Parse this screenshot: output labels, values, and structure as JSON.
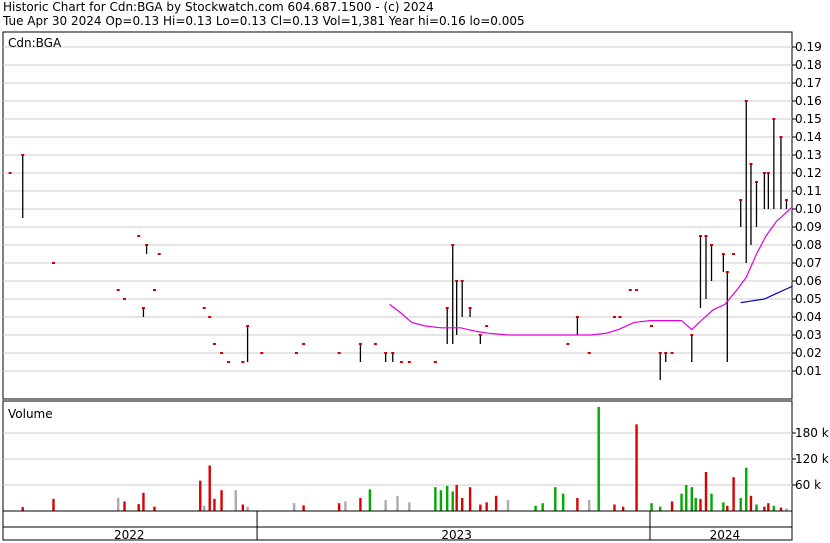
{
  "header": {
    "line1": "Historic Chart for Cdn:BGA by Stockwatch.com 604.687.1500 - (c) 2024",
    "line2": "Tue Apr 30 2024  Op=0.13  Hi=0.13  Lo=0.13  Cl=0.13  Vol=1,381  Year hi=0.16  lo=0.005"
  },
  "chart_data": [
    {
      "type": "ohlc",
      "title": "Cdn:BGA",
      "yticks": [
        "0.19",
        "0.18",
        "0.17",
        "0.16",
        "0.15",
        "0.14",
        "0.13",
        "0.12",
        "0.11",
        "0.10",
        "0.09",
        "0.08",
        "0.07",
        "0.06",
        "0.05",
        "0.04",
        "0.03",
        "0.02",
        "0.01"
      ],
      "ylim": [
        0,
        0.19
      ],
      "xlim": [
        0,
        100
      ],
      "x_axis_note": "x in fractional timeline units; 2022 starts at 0, 2023 at 34.3, 2024 at 84.4",
      "grid": true,
      "colors": {
        "bars": "#000000",
        "close_tick": "#cc0000",
        "ma_short": "#e000e0",
        "ma_long": "#0000cc",
        "grid": "#cccccc"
      },
      "bars": [
        {
          "x": 0.9,
          "l": 0.12,
          "h": 0.12
        },
        {
          "x": 2.5,
          "l": 0.095,
          "h": 0.13
        },
        {
          "x": 6.4,
          "l": 0.07,
          "h": 0.07
        },
        {
          "x": 14.6,
          "l": 0.055,
          "h": 0.055
        },
        {
          "x": 15.4,
          "l": 0.05,
          "h": 0.05
        },
        {
          "x": 17.2,
          "l": 0.085,
          "h": 0.085
        },
        {
          "x": 17.8,
          "l": 0.04,
          "h": 0.045
        },
        {
          "x": 18.2,
          "l": 0.075,
          "h": 0.08
        },
        {
          "x": 19.2,
          "l": 0.055,
          "h": 0.055
        },
        {
          "x": 19.8,
          "l": 0.075,
          "h": 0.075
        },
        {
          "x": 25.5,
          "l": 0.045,
          "h": 0.045
        },
        {
          "x": 26.2,
          "l": 0.04,
          "h": 0.04
        },
        {
          "x": 26.8,
          "l": 0.025,
          "h": 0.025
        },
        {
          "x": 27.7,
          "l": 0.02,
          "h": 0.02
        },
        {
          "x": 28.6,
          "l": 0.015,
          "h": 0.015
        },
        {
          "x": 30.4,
          "l": 0.015,
          "h": 0.015
        },
        {
          "x": 31.0,
          "l": 0.015,
          "h": 0.035
        },
        {
          "x": 32.8,
          "l": 0.02,
          "h": 0.02
        },
        {
          "x": 37.2,
          "l": 0.02,
          "h": 0.02
        },
        {
          "x": 38.1,
          "l": 0.025,
          "h": 0.025
        },
        {
          "x": 42.6,
          "l": 0.02,
          "h": 0.02
        },
        {
          "x": 45.3,
          "l": 0.015,
          "h": 0.025
        },
        {
          "x": 47.2,
          "l": 0.025,
          "h": 0.025
        },
        {
          "x": 48.5,
          "l": 0.015,
          "h": 0.02
        },
        {
          "x": 49.4,
          "l": 0.015,
          "h": 0.02
        },
        {
          "x": 50.5,
          "l": 0.015,
          "h": 0.015
        },
        {
          "x": 51.5,
          "l": 0.015,
          "h": 0.015
        },
        {
          "x": 54.8,
          "l": 0.015,
          "h": 0.015
        },
        {
          "x": 56.3,
          "l": 0.025,
          "h": 0.045
        },
        {
          "x": 57.0,
          "l": 0.025,
          "h": 0.08
        },
        {
          "x": 57.5,
          "l": 0.03,
          "h": 0.06
        },
        {
          "x": 58.2,
          "l": 0.04,
          "h": 0.06
        },
        {
          "x": 59.2,
          "l": 0.04,
          "h": 0.045
        },
        {
          "x": 60.5,
          "l": 0.025,
          "h": 0.03
        },
        {
          "x": 61.3,
          "l": 0.035,
          "h": 0.035
        },
        {
          "x": 71.6,
          "l": 0.025,
          "h": 0.025
        },
        {
          "x": 72.8,
          "l": 0.03,
          "h": 0.04
        },
        {
          "x": 74.3,
          "l": 0.02,
          "h": 0.02
        },
        {
          "x": 77.5,
          "l": 0.04,
          "h": 0.04
        },
        {
          "x": 78.2,
          "l": 0.04,
          "h": 0.04
        },
        {
          "x": 79.5,
          "l": 0.055,
          "h": 0.055
        },
        {
          "x": 80.3,
          "l": 0.055,
          "h": 0.055
        },
        {
          "x": 82.2,
          "l": 0.035,
          "h": 0.035
        },
        {
          "x": 83.3,
          "l": 0.005,
          "h": 0.02
        },
        {
          "x": 84.0,
          "l": 0.015,
          "h": 0.02
        },
        {
          "x": 84.8,
          "l": 0.02,
          "h": 0.02
        },
        {
          "x": 87.3,
          "l": 0.015,
          "h": 0.03
        },
        {
          "x": 88.4,
          "l": 0.045,
          "h": 0.085
        },
        {
          "x": 89.1,
          "l": 0.05,
          "h": 0.085
        },
        {
          "x": 89.8,
          "l": 0.06,
          "h": 0.08
        },
        {
          "x": 91.3,
          "l": 0.065,
          "h": 0.075
        },
        {
          "x": 91.8,
          "l": 0.015,
          "h": 0.065
        },
        {
          "x": 92.6,
          "l": 0.075,
          "h": 0.075
        },
        {
          "x": 93.5,
          "l": 0.09,
          "h": 0.105
        },
        {
          "x": 94.2,
          "l": 0.07,
          "h": 0.16
        },
        {
          "x": 94.8,
          "l": 0.08,
          "h": 0.125
        },
        {
          "x": 95.5,
          "l": 0.09,
          "h": 0.115
        },
        {
          "x": 96.5,
          "l": 0.1,
          "h": 0.12
        },
        {
          "x": 97.0,
          "l": 0.1,
          "h": 0.12
        },
        {
          "x": 97.7,
          "l": 0.1,
          "h": 0.15
        },
        {
          "x": 98.6,
          "l": 0.1,
          "h": 0.14
        },
        {
          "x": 99.3,
          "l": 0.1,
          "h": 0.105
        }
      ],
      "ma_short": [
        [
          49.0,
          0.047
        ],
        [
          50.5,
          0.042
        ],
        [
          51.8,
          0.037
        ],
        [
          53.5,
          0.035
        ],
        [
          55.5,
          0.034
        ],
        [
          58.0,
          0.034
        ],
        [
          60.0,
          0.032
        ],
        [
          61.5,
          0.031
        ],
        [
          64.0,
          0.03
        ],
        [
          68.0,
          0.03
        ],
        [
          72.0,
          0.03
        ],
        [
          74.5,
          0.03
        ],
        [
          76.5,
          0.031
        ],
        [
          78.0,
          0.033
        ],
        [
          80.0,
          0.037
        ],
        [
          82.0,
          0.038
        ],
        [
          86.0,
          0.038
        ],
        [
          87.3,
          0.033
        ],
        [
          88.5,
          0.038
        ],
        [
          90.0,
          0.044
        ],
        [
          91.5,
          0.047
        ],
        [
          93.0,
          0.055
        ],
        [
          94.2,
          0.062
        ],
        [
          95.5,
          0.075
        ],
        [
          96.7,
          0.085
        ],
        [
          98.0,
          0.093
        ],
        [
          99.0,
          0.097
        ],
        [
          100.0,
          0.101
        ]
      ],
      "ma_long": [
        [
          93.5,
          0.048
        ],
        [
          95.0,
          0.049
        ],
        [
          96.5,
          0.05
        ],
        [
          98.0,
          0.053
        ],
        [
          99.0,
          0.055
        ],
        [
          100.0,
          0.057
        ]
      ]
    },
    {
      "type": "bar",
      "title": "Volume",
      "yticks": [
        "180 k",
        "120 k",
        "60 k"
      ],
      "ylim": [
        0,
        240
      ],
      "xlim": [
        0,
        100
      ],
      "colors": {
        "up": "#00aa00",
        "down": "#dd0000",
        "flat": "#aaaaaa",
        "grid": "#cccccc"
      },
      "bars": [
        {
          "x": 2.5,
          "v": 9,
          "c": "down"
        },
        {
          "x": 6.4,
          "v": 28,
          "c": "down"
        },
        {
          "x": 14.6,
          "v": 30,
          "c": "flat"
        },
        {
          "x": 15.4,
          "v": 22,
          "c": "down"
        },
        {
          "x": 17.2,
          "v": 16,
          "c": "down"
        },
        {
          "x": 17.8,
          "v": 42,
          "c": "down"
        },
        {
          "x": 19.2,
          "v": 10,
          "c": "down"
        },
        {
          "x": 25.0,
          "v": 70,
          "c": "down"
        },
        {
          "x": 25.5,
          "v": 12,
          "c": "flat"
        },
        {
          "x": 26.2,
          "v": 105,
          "c": "down"
        },
        {
          "x": 26.8,
          "v": 28,
          "c": "down"
        },
        {
          "x": 27.7,
          "v": 48,
          "c": "down"
        },
        {
          "x": 29.5,
          "v": 48,
          "c": "flat"
        },
        {
          "x": 30.4,
          "v": 15,
          "c": "down"
        },
        {
          "x": 31.0,
          "v": 10,
          "c": "flat"
        },
        {
          "x": 36.9,
          "v": 18,
          "c": "flat"
        },
        {
          "x": 38.1,
          "v": 13,
          "c": "down"
        },
        {
          "x": 42.6,
          "v": 18,
          "c": "down"
        },
        {
          "x": 43.4,
          "v": 22,
          "c": "flat"
        },
        {
          "x": 45.3,
          "v": 30,
          "c": "down"
        },
        {
          "x": 46.5,
          "v": 50,
          "c": "up"
        },
        {
          "x": 48.5,
          "v": 25,
          "c": "flat"
        },
        {
          "x": 50.0,
          "v": 35,
          "c": "flat"
        },
        {
          "x": 51.5,
          "v": 20,
          "c": "flat"
        },
        {
          "x": 54.8,
          "v": 55,
          "c": "up"
        },
        {
          "x": 55.5,
          "v": 48,
          "c": "up"
        },
        {
          "x": 56.3,
          "v": 58,
          "c": "up"
        },
        {
          "x": 57.0,
          "v": 45,
          "c": "up"
        },
        {
          "x": 57.5,
          "v": 60,
          "c": "down"
        },
        {
          "x": 58.2,
          "v": 30,
          "c": "down"
        },
        {
          "x": 59.2,
          "v": 55,
          "c": "down"
        },
        {
          "x": 60.5,
          "v": 15,
          "c": "down"
        },
        {
          "x": 61.3,
          "v": 20,
          "c": "down"
        },
        {
          "x": 62.5,
          "v": 35,
          "c": "down"
        },
        {
          "x": 64.0,
          "v": 25,
          "c": "flat"
        },
        {
          "x": 67.5,
          "v": 12,
          "c": "up"
        },
        {
          "x": 68.4,
          "v": 18,
          "c": "up"
        },
        {
          "x": 70.0,
          "v": 55,
          "c": "up"
        },
        {
          "x": 71.0,
          "v": 40,
          "c": "up"
        },
        {
          "x": 72.8,
          "v": 30,
          "c": "down"
        },
        {
          "x": 74.3,
          "v": 25,
          "c": "flat"
        },
        {
          "x": 75.5,
          "v": 240,
          "c": "up"
        },
        {
          "x": 77.5,
          "v": 15,
          "c": "down"
        },
        {
          "x": 78.6,
          "v": 10,
          "c": "down"
        },
        {
          "x": 80.3,
          "v": 200,
          "c": "down"
        },
        {
          "x": 82.2,
          "v": 18,
          "c": "up"
        },
        {
          "x": 83.3,
          "v": 10,
          "c": "up"
        },
        {
          "x": 84.8,
          "v": 22,
          "c": "down"
        },
        {
          "x": 86.0,
          "v": 40,
          "c": "up"
        },
        {
          "x": 86.6,
          "v": 60,
          "c": "up"
        },
        {
          "x": 87.3,
          "v": 55,
          "c": "up"
        },
        {
          "x": 87.8,
          "v": 30,
          "c": "up"
        },
        {
          "x": 88.4,
          "v": 28,
          "c": "down"
        },
        {
          "x": 89.1,
          "v": 90,
          "c": "down"
        },
        {
          "x": 89.8,
          "v": 40,
          "c": "up"
        },
        {
          "x": 91.3,
          "v": 20,
          "c": "up"
        },
        {
          "x": 91.8,
          "v": 12,
          "c": "down"
        },
        {
          "x": 92.6,
          "v": 78,
          "c": "down"
        },
        {
          "x": 93.5,
          "v": 30,
          "c": "up"
        },
        {
          "x": 94.2,
          "v": 100,
          "c": "up"
        },
        {
          "x": 94.8,
          "v": 35,
          "c": "down"
        },
        {
          "x": 95.5,
          "v": 15,
          "c": "up"
        },
        {
          "x": 96.5,
          "v": 10,
          "c": "down"
        },
        {
          "x": 97.0,
          "v": 18,
          "c": "down"
        },
        {
          "x": 97.7,
          "v": 12,
          "c": "up"
        },
        {
          "x": 98.6,
          "v": 8,
          "c": "down"
        },
        {
          "x": 99.3,
          "v": 6,
          "c": "flat"
        }
      ]
    }
  ],
  "time_axis": {
    "labels": [
      {
        "text": "2022",
        "x": 16.0
      },
      {
        "text": "2023",
        "x": 57.5
      },
      {
        "text": "2024",
        "x": 91.5
      }
    ],
    "separators": [
      32.2,
      82.0
    ]
  }
}
